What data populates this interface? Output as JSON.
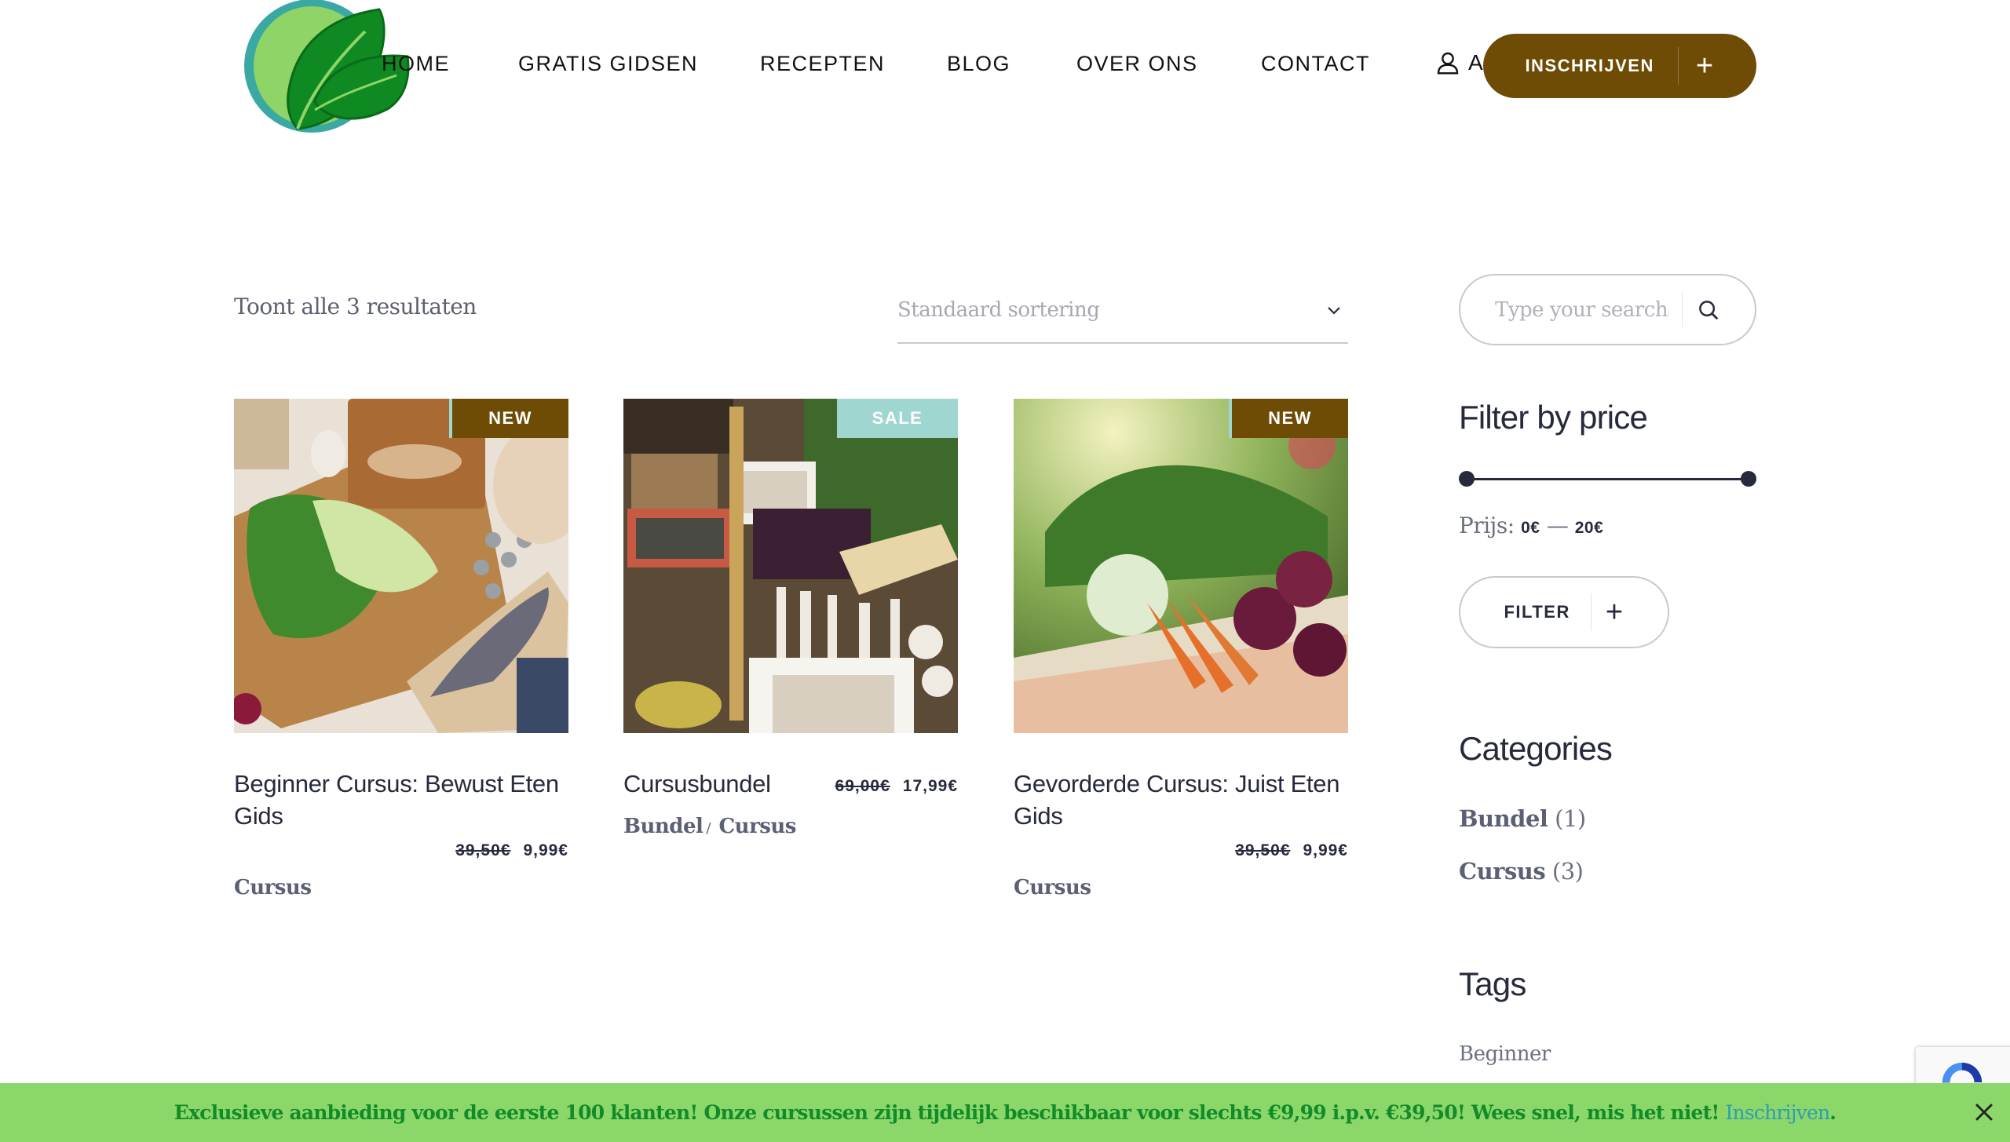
{
  "header": {
    "logo_alt": "Leaf logo",
    "nav": [
      {
        "label": "HOME"
      },
      {
        "label": "GRATIS GIDSEN"
      },
      {
        "label": "RECEPTEN"
      },
      {
        "label": "BLOG"
      },
      {
        "label": "OVER ONS"
      },
      {
        "label": "CONTACT"
      }
    ],
    "account_label": "A",
    "cta_label": "INSCHRIJVEN",
    "cta_icon": "+"
  },
  "shop": {
    "results_text": "Toont alle 3 resultaten",
    "sort": {
      "selected": "Standaard sortering"
    }
  },
  "products": [
    {
      "title": "Beginner Cursus: Bewust Eten Gids",
      "badge": "NEW",
      "old_price": "39,50€",
      "price": "9,99€",
      "categories": [
        "Cursus"
      ],
      "image": "cooking ingredients on cutting boards with fish"
    },
    {
      "title": "Cursusbundel",
      "badge": "SALE",
      "old_price": "69,00€",
      "price": "17,99€",
      "categories": [
        "Bundel",
        "Cursus"
      ],
      "category_separator": "/",
      "image": "market stall with mushrooms and price signs"
    },
    {
      "title": "Gevorderde Cursus: Juist Eten Gids",
      "badge": "NEW",
      "old_price": "39,50€",
      "price": "9,99€",
      "categories": [
        "Cursus"
      ],
      "image": "basket of vegetables with carrots and beets"
    }
  ],
  "sidebar": {
    "search_placeholder": "Type your search",
    "price_filter": {
      "title": "Filter by price",
      "label": "Prijs:",
      "min": "0€",
      "dash": "—",
      "max": "20€",
      "min_value": 0,
      "max_value": 20,
      "range_min": 0,
      "range_max": 20,
      "button_label": "FILTER",
      "button_icon": "+"
    },
    "categories": {
      "title": "Categories",
      "items": [
        {
          "name": "Bundel",
          "count": "(1)"
        },
        {
          "name": "Cursus",
          "count": "(3)"
        }
      ]
    },
    "tags": {
      "title": "Tags",
      "items": [
        "Beginner"
      ]
    }
  },
  "banner": {
    "text": "Exclusieve aanbieding voor de eerste 100 klanten! Onze cursussen zijn tijdelijk beschikbaar voor slechts €9,99 i.p.v. €39,50! Wees snel, mis het niet! ",
    "link_label": "Inschrijven",
    "suffix": ".",
    "close_icon": "close-x"
  },
  "colors": {
    "brand_brown": "#6e4c05",
    "sale_teal": "#9fd6cf",
    "banner_green": "#8cd76a",
    "banner_text": "#128c28",
    "link_teal": "#2d9eb2",
    "text_dark": "#262a3c"
  }
}
